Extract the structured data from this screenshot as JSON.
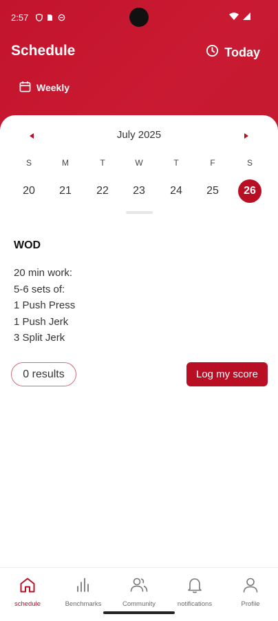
{
  "status_bar": {
    "time": "2:57"
  },
  "header": {
    "title": "Schedule",
    "today_label": "Today",
    "view_label": "Weekly"
  },
  "calendar": {
    "month": "July 2025",
    "weekdays": [
      "S",
      "M",
      "T",
      "W",
      "T",
      "F",
      "S"
    ],
    "days": [
      "20",
      "21",
      "22",
      "23",
      "24",
      "25",
      "26"
    ],
    "selected_day": "26"
  },
  "workout": {
    "title": "WOD",
    "lines": [
      "20 min work:",
      "5-6 sets of:",
      "1 Push Press",
      "1 Push Jerk",
      "3 Split Jerk"
    ]
  },
  "actions": {
    "results_label": "0 results",
    "log_label": "Log my score"
  },
  "nav": {
    "items": [
      {
        "label": "schedule",
        "icon": "home-icon",
        "active": true
      },
      {
        "label": "Benchmarks",
        "icon": "bar-chart-icon",
        "active": false
      },
      {
        "label": "Community",
        "icon": "people-icon",
        "active": false
      },
      {
        "label": "notifications",
        "icon": "bell-icon",
        "active": false
      },
      {
        "label": "Profile",
        "icon": "person-icon",
        "active": false
      }
    ]
  },
  "colors": {
    "brand": "#c2142c",
    "accent": "#b90f25"
  }
}
